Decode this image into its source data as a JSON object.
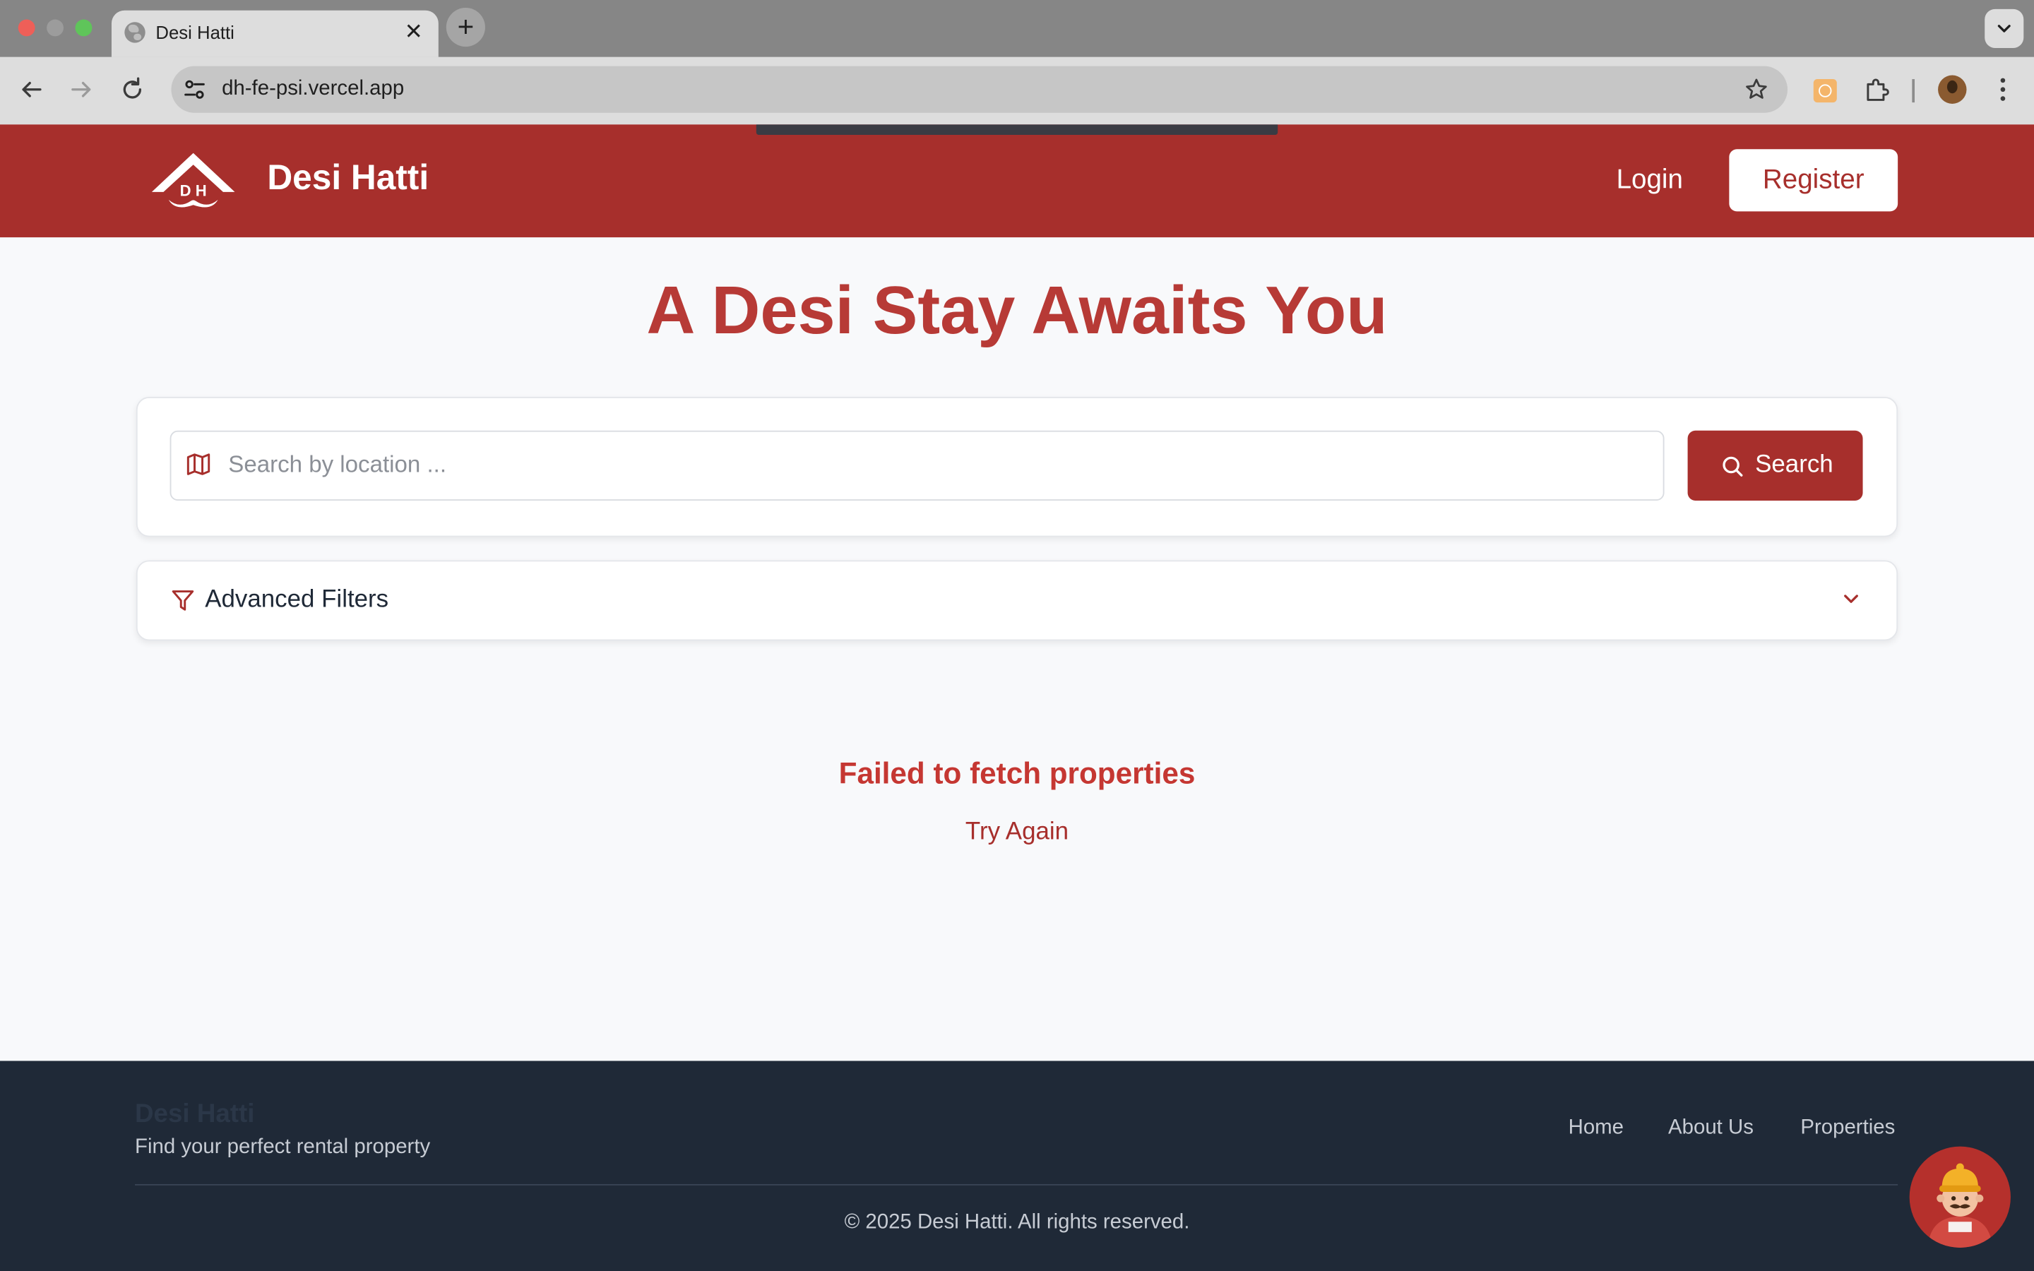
{
  "browser": {
    "tab_title": "Desi Hatti",
    "close_glyph": "✕",
    "new_tab_glyph": "+",
    "url": "dh-fe-psi.vercel.app"
  },
  "header": {
    "logo_text": "D H",
    "brand": "Desi Hatti",
    "login_label": "Login",
    "register_label": "Register"
  },
  "hero": {
    "title": "A Desi Stay Awaits You"
  },
  "search": {
    "placeholder": "Search by location ...",
    "value": "",
    "button_label": "Search"
  },
  "filters": {
    "label": "Advanced Filters"
  },
  "status": {
    "error_message": "Failed to fetch properties",
    "retry_label": "Try Again"
  },
  "footer": {
    "brand": "Desi Hatti",
    "tagline": "Find your perfect rental property",
    "links": [
      {
        "label": "Home"
      },
      {
        "label": "About Us"
      },
      {
        "label": "Properties"
      }
    ],
    "copyright": "© 2025 Desi Hatti. All rights reserved."
  },
  "colors": {
    "brand_red": "#a72f2c",
    "hero_red": "#b73a36",
    "error_red": "#c53732",
    "footer_bg": "#1f2937",
    "page_bg": "#f8f9fb"
  },
  "icons": {
    "tab_favicon": "globe-icon",
    "back": "arrow-left-icon",
    "forward": "arrow-right-icon",
    "reload": "reload-icon",
    "site_info": "tune-icon",
    "bookmark": "star-icon",
    "extension": "extension-icon",
    "extensions_menu": "puzzle-icon",
    "profile": "avatar",
    "browser_menu": "kebab-icon",
    "search_field": "map-icon",
    "search_button": "search-icon",
    "filters": "filter-icon",
    "filters_toggle": "chevron-down-icon",
    "assistant": "chatbot-avatar"
  }
}
